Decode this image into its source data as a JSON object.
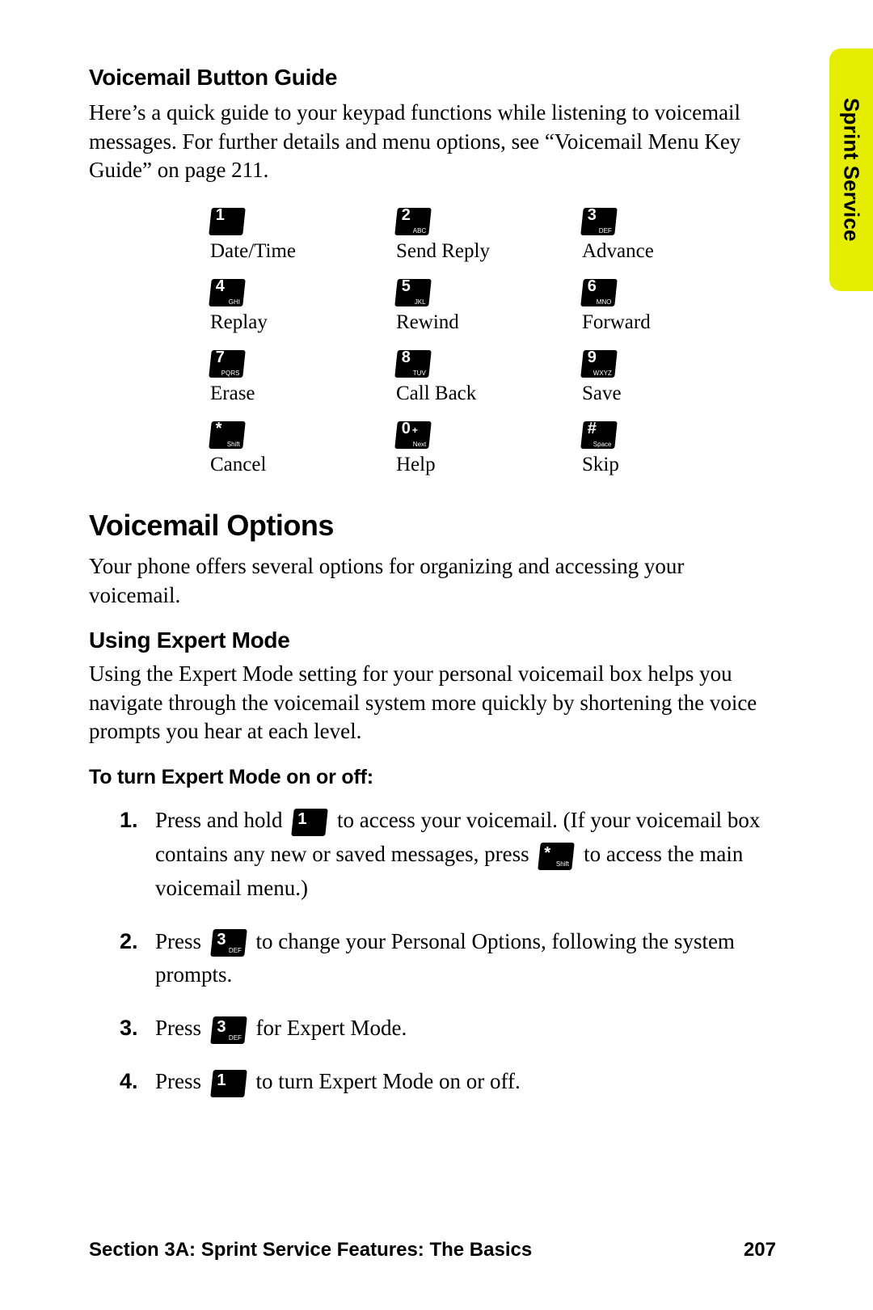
{
  "tab": "Sprint Service",
  "section1": {
    "title": "Voicemail Button Guide",
    "body": "Here’s a quick guide to your keypad functions while listening to voicemail messages. For further details and menu options, see “Voicemail Menu Key Guide” on page 211."
  },
  "keypad": [
    [
      {
        "main": "1",
        "sub": "",
        "label": "Date/Time",
        "name": "key-1"
      },
      {
        "main": "2",
        "sub": "ABC",
        "label": "Send Reply",
        "name": "key-2"
      },
      {
        "main": "3",
        "sub": "DEF",
        "label": "Advance",
        "name": "key-3"
      }
    ],
    [
      {
        "main": "4",
        "sub": "GHI",
        "label": "Replay",
        "name": "key-4"
      },
      {
        "main": "5",
        "sub": "JKL",
        "label": "Rewind",
        "name": "key-5"
      },
      {
        "main": "6",
        "sub": "MNO",
        "label": "Forward",
        "name": "key-6"
      }
    ],
    [
      {
        "main": "7",
        "sub": "PQRS",
        "label": "Erase",
        "name": "key-7"
      },
      {
        "main": "8",
        "sub": "TUV",
        "label": "Call Back",
        "name": "key-8"
      },
      {
        "main": "9",
        "sub": "WXYZ",
        "label": "Save",
        "name": "key-9"
      }
    ],
    [
      {
        "main": "*",
        "sub": "Shift",
        "label": "Cancel",
        "name": "key-star"
      },
      {
        "main": "0",
        "sub": "Next",
        "ext": "+",
        "label": "Help",
        "name": "key-0"
      },
      {
        "main": "#",
        "sub": "Space",
        "label": "Skip",
        "name": "key-hash"
      }
    ]
  ],
  "section2": {
    "title": "Voicemail Options",
    "body": "Your phone offers several options for organizing and accessing your voicemail.",
    "sub_title": "Using Expert Mode",
    "sub_body": "Using the Expert Mode setting for your personal voicemail box helps you navigate through the voicemail system more quickly by shortening the voice prompts you hear at each level.",
    "lead": "To turn Expert Mode on or off:"
  },
  "steps": [
    {
      "num": "1.",
      "parts": [
        {
          "t": "Press and hold "
        },
        {
          "key": {
            "main": "1",
            "sub": "",
            "name": "inline-key-1-a"
          }
        },
        {
          "t": " to access your voicemail. (If your voicemail box contains any new or saved messages, press "
        },
        {
          "key": {
            "main": "*",
            "sub": "Shift",
            "name": "inline-key-star"
          }
        },
        {
          "t": " to access the main voicemail menu.)"
        }
      ]
    },
    {
      "num": "2.",
      "parts": [
        {
          "t": "Press "
        },
        {
          "key": {
            "main": "3",
            "sub": "DEF",
            "name": "inline-key-3-a"
          }
        },
        {
          "t": " to change your Personal Options, following the system prompts."
        }
      ]
    },
    {
      "num": "3.",
      "parts": [
        {
          "t": "Press "
        },
        {
          "key": {
            "main": "3",
            "sub": "DEF",
            "name": "inline-key-3-b"
          }
        },
        {
          "t": " for Expert Mode."
        }
      ]
    },
    {
      "num": "4.",
      "parts": [
        {
          "t": "Press "
        },
        {
          "key": {
            "main": "1",
            "sub": "",
            "name": "inline-key-1-b"
          }
        },
        {
          "t": " to turn Expert Mode on or off."
        }
      ]
    }
  ],
  "footer": {
    "left": "Section 3A: Sprint Service Features: The Basics",
    "right": "207"
  }
}
